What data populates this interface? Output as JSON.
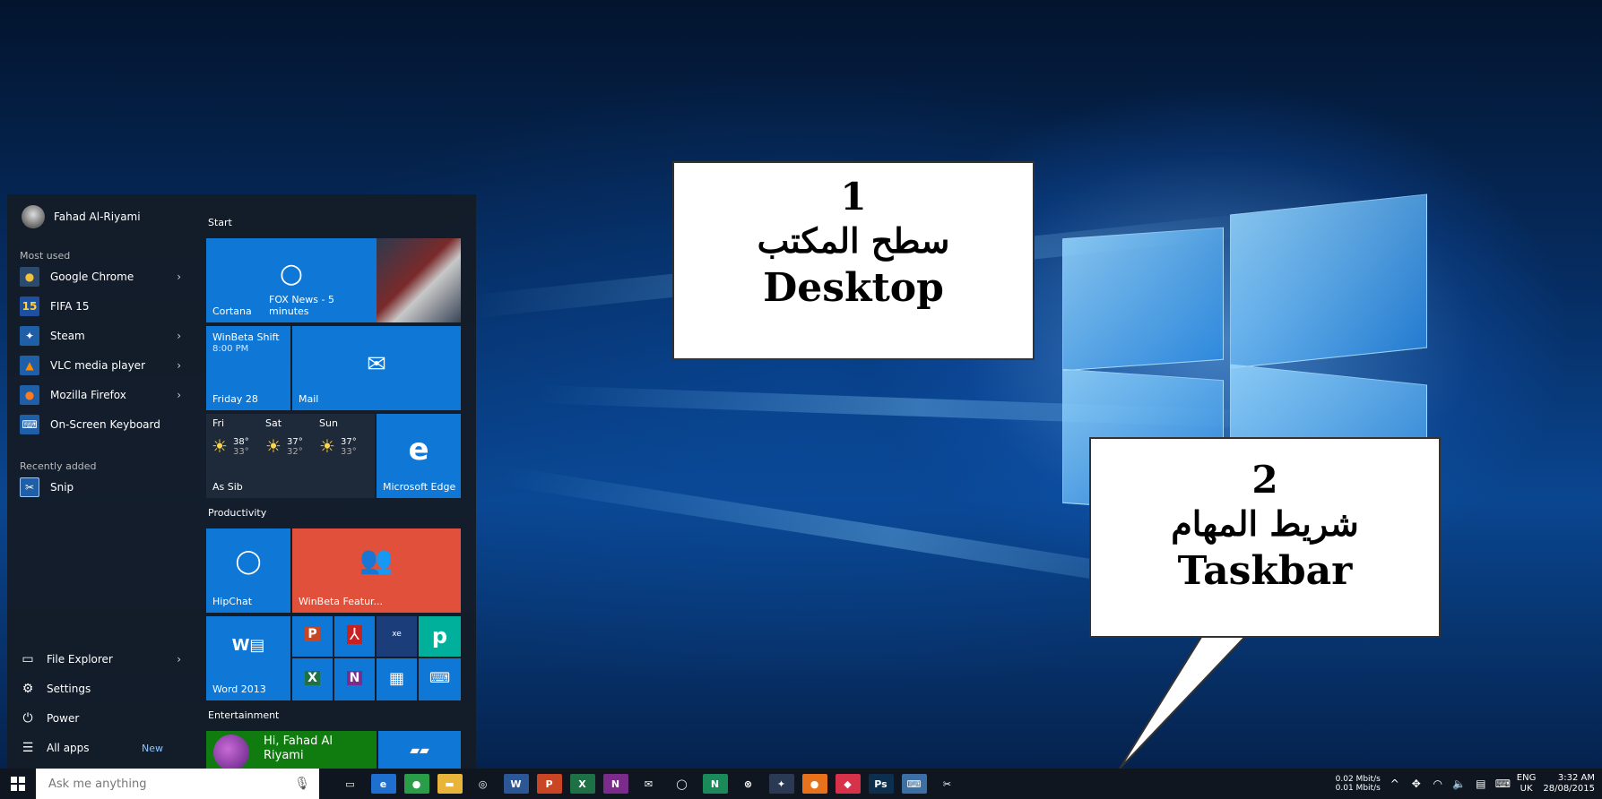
{
  "callouts": [
    {
      "number": "1",
      "arabic": "سطح المكتب",
      "english": "Desktop"
    },
    {
      "number": "2",
      "arabic": "شريط المهام",
      "english": "Taskbar"
    }
  ],
  "start_menu": {
    "user_name": "Fahad Al-Riyami",
    "most_used_label": "Most used",
    "most_used": [
      {
        "label": "Google Chrome",
        "icon": "chrome-icon",
        "has_submenu": true
      },
      {
        "label": "FIFA 15",
        "icon": "fifa-icon",
        "has_submenu": false
      },
      {
        "label": "Steam",
        "icon": "steam-icon",
        "has_submenu": true
      },
      {
        "label": "VLC media player",
        "icon": "vlc-icon",
        "has_submenu": true
      },
      {
        "label": "Mozilla Firefox",
        "icon": "firefox-icon",
        "has_submenu": true
      },
      {
        "label": "On-Screen Keyboard",
        "icon": "keyboard-icon",
        "has_submenu": false
      }
    ],
    "recently_added_label": "Recently added",
    "recently_added": [
      {
        "label": "Snip",
        "icon": "snip-icon"
      }
    ],
    "bottom": {
      "file_explorer": "File Explorer",
      "settings": "Settings",
      "power": "Power",
      "all_apps": "All apps",
      "new_badge": "New"
    },
    "tiles": {
      "start_label": "Start",
      "cortana": "Cortana",
      "fox_news": "FOX News - 5 minutes",
      "winbeta_shift": "WinBeta Shift",
      "winbeta_time": "8:00 PM",
      "calendar_date": "Friday 28",
      "mail": "Mail",
      "weather": {
        "location": "As Sib",
        "days": [
          {
            "day": "Fri",
            "high": "38°",
            "low": "33°"
          },
          {
            "day": "Sat",
            "high": "37°",
            "low": "32°"
          },
          {
            "day": "Sun",
            "high": "37°",
            "low": "33°"
          }
        ]
      },
      "edge": "Microsoft Edge",
      "productivity_label": "Productivity",
      "hipchat": "HipChat",
      "winbeta_feature": "WinBeta Featur...",
      "word": "Word 2013",
      "entertainment_label": "Entertainment",
      "xbox_greeting": "Hi, Fahad Al Riyami"
    }
  },
  "taskbar": {
    "search_placeholder": "Ask me anything",
    "apps": [
      {
        "name": "task-view-icon",
        "glyph": "▭",
        "color": "#0f1620"
      },
      {
        "name": "edge-icon",
        "glyph": "e",
        "color": "#1e6fd0"
      },
      {
        "name": "chrome-icon",
        "glyph": "●",
        "color": "#2a9d49"
      },
      {
        "name": "file-explorer-icon",
        "glyph": "▬",
        "color": "#e8b53a"
      },
      {
        "name": "groove-icon",
        "glyph": "◎",
        "color": "#0f1620"
      },
      {
        "name": "word-icon",
        "glyph": "W",
        "color": "#2b5797"
      },
      {
        "name": "powerpoint-icon",
        "glyph": "P",
        "color": "#c94624"
      },
      {
        "name": "excel-icon",
        "glyph": "X",
        "color": "#1e7145"
      },
      {
        "name": "onenote-icon",
        "glyph": "N",
        "color": "#7b2c8a"
      },
      {
        "name": "mail-icon",
        "glyph": "✉",
        "color": "#0f1620"
      },
      {
        "name": "hipchat-icon",
        "glyph": "◯",
        "color": "#0f1620"
      },
      {
        "name": "nextgen-reader-icon",
        "glyph": "N",
        "color": "#1b8a5a"
      },
      {
        "name": "xbox-icon",
        "glyph": "⊗",
        "color": "#0f1620"
      },
      {
        "name": "steam-icon",
        "glyph": "✦",
        "color": "#2a3a55"
      },
      {
        "name": "origin-icon",
        "glyph": "●",
        "color": "#e8721c"
      },
      {
        "name": "pocket-icon",
        "glyph": "◆",
        "color": "#d8314a"
      },
      {
        "name": "photoshop-icon",
        "glyph": "Ps",
        "color": "#0b2f4d"
      },
      {
        "name": "keyboard-tool-icon",
        "glyph": "⌨",
        "color": "#3c6fa3"
      },
      {
        "name": "snip-icon",
        "glyph": "✂",
        "color": "#0f1620"
      }
    ],
    "tray": {
      "net_up": "0.02 Mbit/s",
      "net_down": "0.01 Mbit/s",
      "lang_top": "ENG",
      "lang_bottom": "UK",
      "time": "3:32 AM",
      "date": "28/08/2015"
    }
  },
  "colors": {
    "tile_blue": "#0f78d7",
    "tile_red": "#e1503a",
    "tile_teal": "#00b09b",
    "tile_green": "#107c10",
    "taskbar": "#0f1620"
  }
}
